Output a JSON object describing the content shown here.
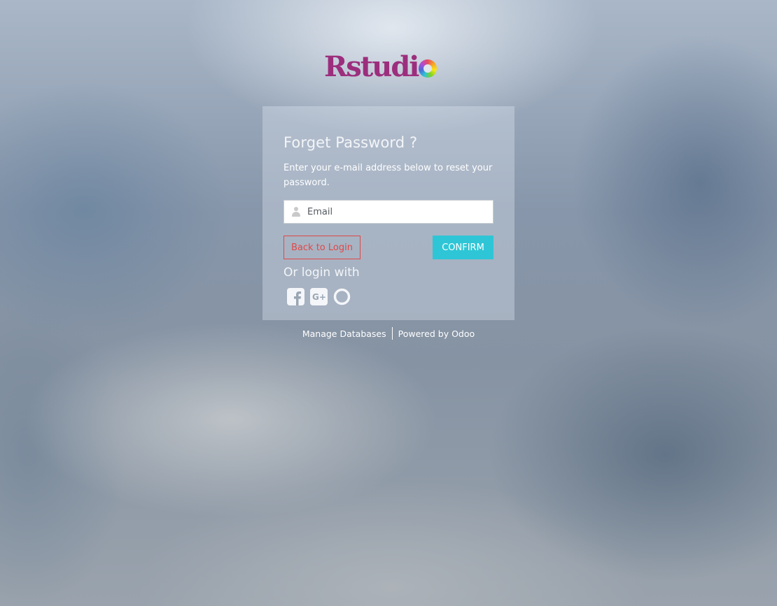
{
  "brand": {
    "logo_text": "Rstudi",
    "logo_color": "#9c2e7d"
  },
  "form": {
    "title": "Forget Password ?",
    "subtitle": "Enter your e-mail address below to reset your password.",
    "email": {
      "value": "",
      "placeholder": "Email",
      "icon": "user-icon"
    },
    "back_label": "Back to Login",
    "confirm_label": "CONFIRM",
    "or_login_label": "Or login with",
    "social": [
      {
        "icon": "facebook-icon"
      },
      {
        "icon": "google-plus-icon"
      },
      {
        "icon": "odoo-icon"
      }
    ]
  },
  "footer": {
    "manage_databases": "Manage Databases",
    "powered_by": "Powered by Odoo"
  },
  "colors": {
    "accent": "#2ec6d6",
    "danger": "#e04848"
  }
}
